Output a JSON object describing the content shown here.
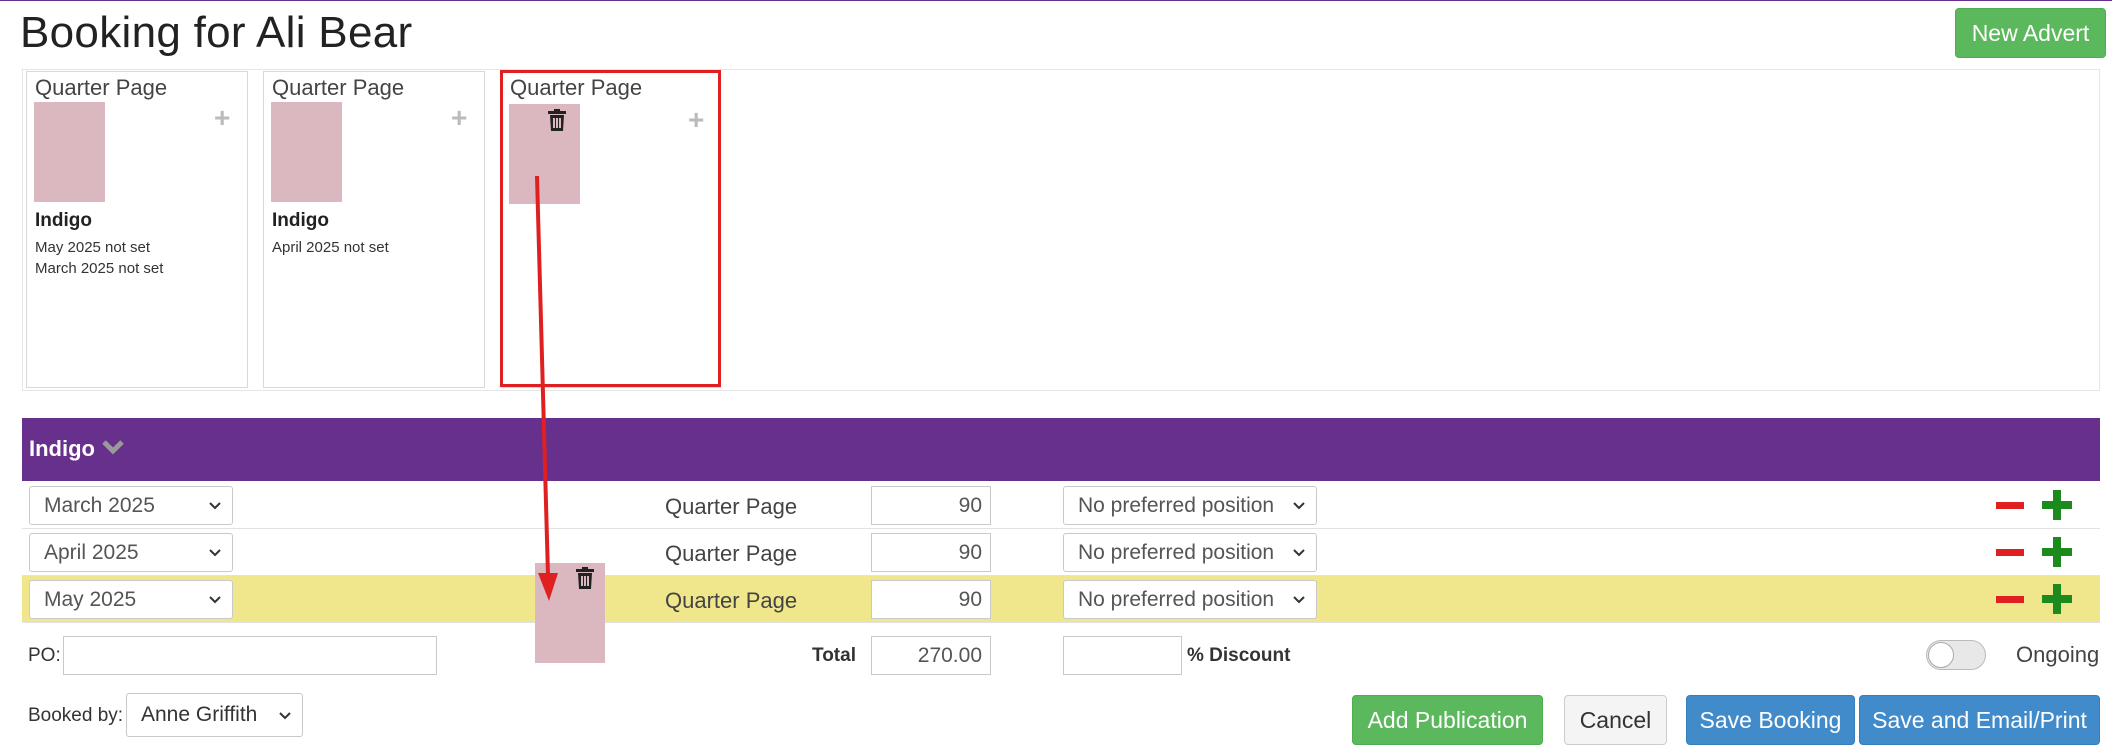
{
  "page": {
    "title": "Booking for Ali Bear"
  },
  "header": {
    "new_advert_label": "New Advert"
  },
  "cards": [
    {
      "title": "Quarter Page",
      "publication": "Indigo",
      "notes": [
        "May 2025 not set",
        "March 2025 not set"
      ]
    },
    {
      "title": "Quarter Page",
      "publication": "Indigo",
      "notes": [
        "April 2025 not set"
      ]
    },
    {
      "title": "Quarter Page",
      "publication": "",
      "notes": []
    }
  ],
  "publication_bar": {
    "name": "Indigo"
  },
  "rows": [
    {
      "issue": "March 2025",
      "size": "Quarter Page",
      "price": "90",
      "position": "No preferred position"
    },
    {
      "issue": "April 2025",
      "size": "Quarter Page",
      "price": "90",
      "position": "No preferred position"
    },
    {
      "issue": "May 2025",
      "size": "Quarter Page",
      "price": "90",
      "position": "No preferred position"
    }
  ],
  "totals": {
    "po_label": "PO:",
    "total_label": "Total",
    "total_value": "270.00",
    "discount_label": "% Discount",
    "ongoing_label": "Ongoing"
  },
  "footer": {
    "booked_by_label": "Booked by:",
    "booked_by_value": "Anne Griffith",
    "add_publication_label": "Add Publication",
    "cancel_label": "Cancel",
    "save_booking_label": "Save Booking",
    "save_email_label": "Save and Email/Print"
  },
  "colors": {
    "brand_purple": "#66308c",
    "highlight_row": "#f0e68c",
    "thumb_pink": "#dbb8c0",
    "annotation_red": "#e02020"
  },
  "icons": [
    "plus-icon",
    "trash-icon",
    "chevron-down-icon",
    "minus-icon"
  ]
}
